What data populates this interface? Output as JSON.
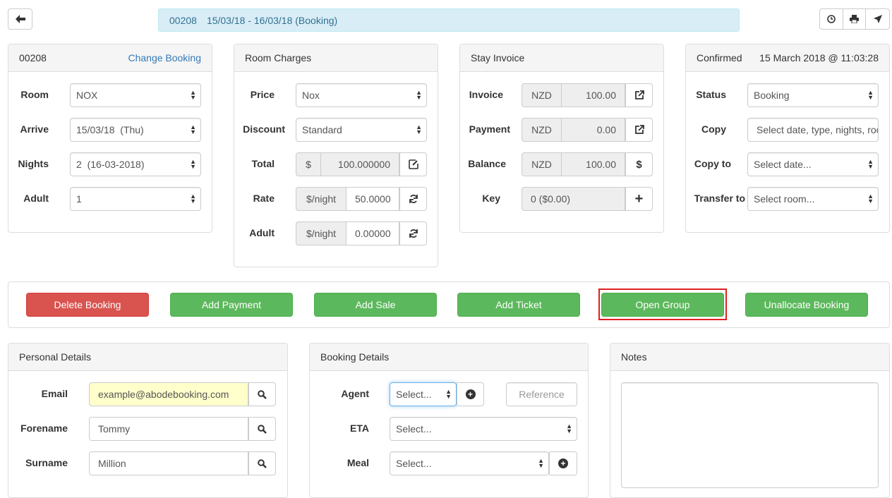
{
  "header": {
    "booking_number": "00208",
    "banner_text": "15/03/18 - 16/03/18  (Booking)"
  },
  "icons": {
    "back": "arrow-left-icon",
    "history": "clock-icon",
    "print": "printer-icon",
    "send": "send-icon"
  },
  "booking_panel": {
    "title": "00208",
    "change_link": "Change Booking",
    "room_label": "Room",
    "room_value": "NOX",
    "arrive_label": "Arrive",
    "arrive_value": "15/03/18  (Thu)",
    "nights_label": "Nights",
    "nights_value": "2  (16-03-2018)",
    "adult_label": "Adult",
    "adult_value": "1"
  },
  "room_charges": {
    "title": "Room Charges",
    "price_label": "Price",
    "price_value": "Nox",
    "discount_label": "Discount",
    "discount_value": "Standard",
    "total_label": "Total",
    "total_prefix": "$",
    "total_value": "100.000000",
    "rate_label": "Rate",
    "rate_unit": "$/night",
    "rate_value": "50.0000",
    "adult_label": "Adult",
    "adult_unit": "$/night",
    "adult_value": "0.00000"
  },
  "stay_invoice": {
    "title": "Stay Invoice",
    "invoice_label": "Invoice",
    "invoice_currency": "NZD",
    "invoice_value": "100.00",
    "payment_label": "Payment",
    "payment_currency": "NZD",
    "payment_value": "0.00",
    "balance_label": "Balance",
    "balance_currency": "NZD",
    "balance_value": "100.00",
    "balance_button": "$",
    "key_label": "Key",
    "key_value": "0 ($0.00)",
    "key_button": "+"
  },
  "status_panel": {
    "status_title": "Confirmed",
    "timestamp": "15 March 2018 @ 11:03:28",
    "status_label": "Status",
    "status_value": "Booking",
    "copy_label": "Copy",
    "copy_value": "Select date, type, nights, room...",
    "copy_to_label": "Copy to",
    "copy_to_value": "Select date...",
    "transfer_label": "Transfer to",
    "transfer_value": "Select room..."
  },
  "actions": {
    "delete": "Delete Booking",
    "add_payment": "Add Payment",
    "add_sale": "Add Sale",
    "add_ticket": "Add Ticket",
    "open_group": "Open Group",
    "unallocate": "Unallocate Booking"
  },
  "personal": {
    "title": "Personal Details",
    "email_label": "Email",
    "email_value": "example@abodebooking.com",
    "forename_label": "Forename",
    "forename_value": "Tommy",
    "surname_label": "Surname",
    "surname_value": "Million"
  },
  "booking_details": {
    "title": "Booking Details",
    "agent_label": "Agent",
    "agent_value": "Select...",
    "reference_placeholder": "Reference",
    "eta_label": "ETA",
    "eta_value": "Select...",
    "meal_label": "Meal",
    "meal_value": "Select..."
  },
  "notes": {
    "title": "Notes"
  },
  "colors": {
    "primary_link": "#337ab7",
    "success": "#5cb85c",
    "danger": "#d9534f",
    "info_bg": "#d9edf7",
    "highlight_border": "#e02020"
  }
}
